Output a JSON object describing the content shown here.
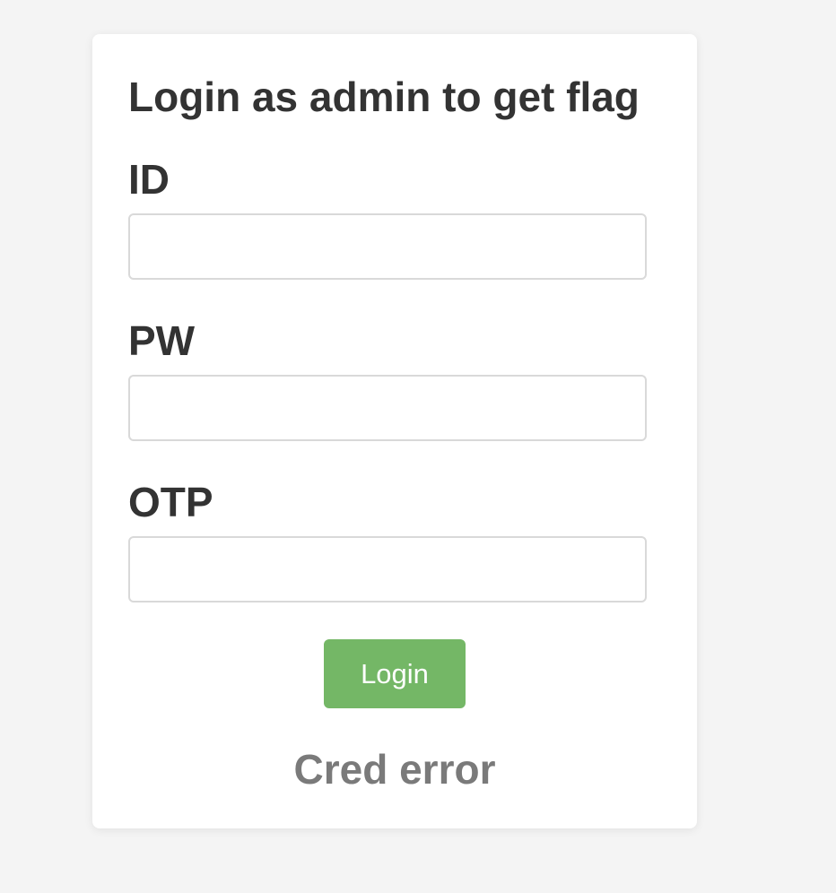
{
  "login_form": {
    "title": "Login as admin to get flag",
    "fields": [
      {
        "label": "ID",
        "value": "",
        "placeholder": ""
      },
      {
        "label": "PW",
        "value": "",
        "placeholder": ""
      },
      {
        "label": "OTP",
        "value": "",
        "placeholder": ""
      }
    ],
    "submit_label": "Login",
    "error_message": "Cred error"
  },
  "colors": {
    "background": "#f4f4f4",
    "card": "#ffffff",
    "text": "#333333",
    "button": "#74b766",
    "error": "#7a7a7a"
  }
}
